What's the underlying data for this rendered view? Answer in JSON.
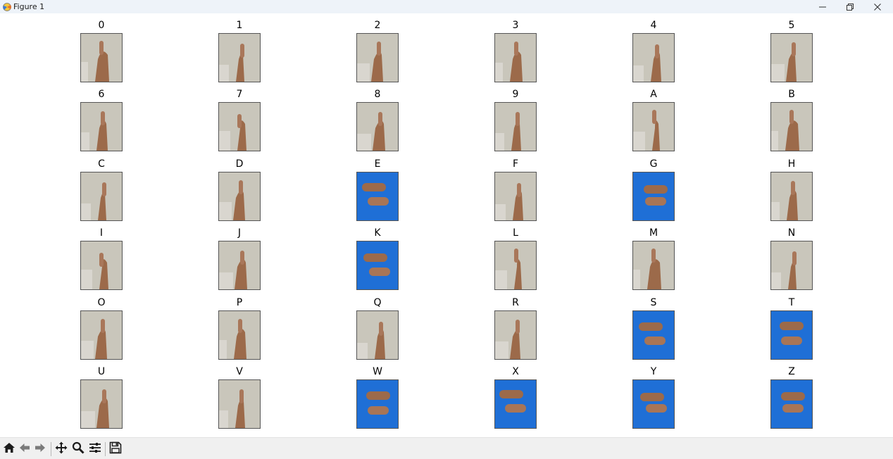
{
  "window": {
    "title": "Figure 1",
    "app_icon": "matplotlib-icon",
    "controls": [
      "minimize-icon",
      "restore-icon",
      "close-icon"
    ]
  },
  "figure": {
    "rows": [
      [
        {
          "label": "0",
          "bg": "beige"
        },
        {
          "label": "1",
          "bg": "beige"
        },
        {
          "label": "2",
          "bg": "beige"
        },
        {
          "label": "3",
          "bg": "beige"
        },
        {
          "label": "4",
          "bg": "beige"
        },
        {
          "label": "5",
          "bg": "beige"
        }
      ],
      [
        {
          "label": "6",
          "bg": "beige"
        },
        {
          "label": "7",
          "bg": "beige"
        },
        {
          "label": "8",
          "bg": "beige"
        },
        {
          "label": "9",
          "bg": "beige"
        },
        {
          "label": "A",
          "bg": "beige"
        },
        {
          "label": "B",
          "bg": "beige"
        }
      ],
      [
        {
          "label": "C",
          "bg": "beige"
        },
        {
          "label": "D",
          "bg": "beige"
        },
        {
          "label": "E",
          "bg": "blue"
        },
        {
          "label": "F",
          "bg": "beige"
        },
        {
          "label": "G",
          "bg": "blue"
        },
        {
          "label": "H",
          "bg": "beige"
        }
      ],
      [
        {
          "label": "I",
          "bg": "beige"
        },
        {
          "label": "J",
          "bg": "beige"
        },
        {
          "label": "K",
          "bg": "blue"
        },
        {
          "label": "L",
          "bg": "beige"
        },
        {
          "label": "M",
          "bg": "beige"
        },
        {
          "label": "N",
          "bg": "beige"
        }
      ],
      [
        {
          "label": "O",
          "bg": "beige"
        },
        {
          "label": "P",
          "bg": "beige"
        },
        {
          "label": "Q",
          "bg": "beige"
        },
        {
          "label": "R",
          "bg": "beige"
        },
        {
          "label": "S",
          "bg": "blue"
        },
        {
          "label": "T",
          "bg": "blue"
        }
      ],
      [
        {
          "label": "U",
          "bg": "beige"
        },
        {
          "label": "V",
          "bg": "beige"
        },
        {
          "label": "W",
          "bg": "blue"
        },
        {
          "label": "X",
          "bg": "blue"
        },
        {
          "label": "Y",
          "bg": "blue"
        },
        {
          "label": "Z",
          "bg": "blue"
        }
      ]
    ]
  },
  "toolbar": {
    "buttons": [
      "home-icon",
      "back-icon",
      "forward-icon",
      "pan-icon",
      "zoom-icon",
      "configure-subplots-icon",
      "save-icon"
    ]
  },
  "colors": {
    "titlebar": "#eef3f9",
    "toolbar": "#f0f0f0",
    "photo_wall": "#c9c6bb",
    "shirt_blue": "#1f6fd6",
    "skin": "#9c6a4a"
  }
}
